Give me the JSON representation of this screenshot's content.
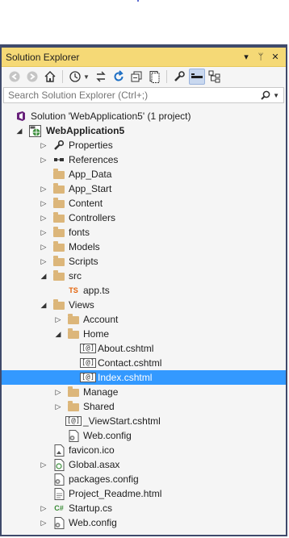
{
  "window": {
    "title": "Solution Explorer",
    "title_buttons": [
      "▾",
      "ᛘ",
      "✕"
    ]
  },
  "search": {
    "placeholder": "Search Solution Explorer (Ctrl+;)"
  },
  "tree": [
    {
      "label": "Solution 'WebApplication5' (1 project)",
      "depth": 0,
      "expander": "",
      "icon": "solution-icon",
      "bold": false,
      "selected": false
    },
    {
      "label": "WebApplication5",
      "depth": 0,
      "expander": "open",
      "icon": "web-project-icon",
      "bold": true,
      "selected": false
    },
    {
      "label": "Properties",
      "depth": 1,
      "expander": "closed",
      "icon": "wrench-icon",
      "bold": false,
      "selected": false
    },
    {
      "label": "References",
      "depth": 1,
      "expander": "closed",
      "icon": "references-icon",
      "bold": false,
      "selected": false
    },
    {
      "label": "App_Data",
      "depth": 1,
      "expander": "",
      "icon": "folder-icon",
      "bold": false,
      "selected": false
    },
    {
      "label": "App_Start",
      "depth": 1,
      "expander": "closed",
      "icon": "folder-icon",
      "bold": false,
      "selected": false
    },
    {
      "label": "Content",
      "depth": 1,
      "expander": "closed",
      "icon": "folder-icon",
      "bold": false,
      "selected": false
    },
    {
      "label": "Controllers",
      "depth": 1,
      "expander": "closed",
      "icon": "folder-icon",
      "bold": false,
      "selected": false
    },
    {
      "label": "fonts",
      "depth": 1,
      "expander": "closed",
      "icon": "folder-icon",
      "bold": false,
      "selected": false
    },
    {
      "label": "Models",
      "depth": 1,
      "expander": "closed",
      "icon": "folder-icon",
      "bold": false,
      "selected": false
    },
    {
      "label": "Scripts",
      "depth": 1,
      "expander": "closed",
      "icon": "folder-icon",
      "bold": false,
      "selected": false
    },
    {
      "label": "src",
      "depth": 1,
      "expander": "open",
      "icon": "folder-icon",
      "bold": false,
      "selected": false
    },
    {
      "label": "app.ts",
      "depth": 2,
      "expander": "",
      "icon": "typescript-icon",
      "bold": false,
      "selected": false
    },
    {
      "label": "Views",
      "depth": 1,
      "expander": "open",
      "icon": "folder-icon",
      "bold": false,
      "selected": false
    },
    {
      "label": "Account",
      "depth": 2,
      "expander": "closed",
      "icon": "folder-icon",
      "bold": false,
      "selected": false
    },
    {
      "label": "Home",
      "depth": 2,
      "expander": "open",
      "icon": "folder-icon",
      "bold": false,
      "selected": false
    },
    {
      "label": "About.cshtml",
      "depth": 3,
      "expander": "",
      "icon": "razor-icon",
      "bold": false,
      "selected": false
    },
    {
      "label": "Contact.cshtml",
      "depth": 3,
      "expander": "",
      "icon": "razor-icon",
      "bold": false,
      "selected": false
    },
    {
      "label": "Index.cshtml",
      "depth": 3,
      "expander": "",
      "icon": "razor-icon",
      "bold": false,
      "selected": true
    },
    {
      "label": "Manage",
      "depth": 2,
      "expander": "closed",
      "icon": "folder-icon",
      "bold": false,
      "selected": false
    },
    {
      "label": "Shared",
      "depth": 2,
      "expander": "closed",
      "icon": "folder-icon",
      "bold": false,
      "selected": false
    },
    {
      "label": "_ViewStart.cshtml",
      "depth": 2,
      "expander": "",
      "icon": "razor-icon",
      "bold": false,
      "selected": false
    },
    {
      "label": "Web.config",
      "depth": 2,
      "expander": "",
      "icon": "config-file-icon",
      "bold": false,
      "selected": false
    },
    {
      "label": "favicon.ico",
      "depth": 1,
      "expander": "",
      "icon": "image-file-icon",
      "bold": false,
      "selected": false
    },
    {
      "label": "Global.asax",
      "depth": 1,
      "expander": "closed",
      "icon": "global-asax-icon",
      "bold": false,
      "selected": false
    },
    {
      "label": "packages.config",
      "depth": 1,
      "expander": "",
      "icon": "config-file-icon",
      "bold": false,
      "selected": false
    },
    {
      "label": "Project_Readme.html",
      "depth": 1,
      "expander": "",
      "icon": "html-file-icon",
      "bold": false,
      "selected": false
    },
    {
      "label": "Startup.cs",
      "depth": 1,
      "expander": "closed",
      "icon": "csharp-icon",
      "bold": false,
      "selected": false
    },
    {
      "label": "Web.config",
      "depth": 1,
      "expander": "closed",
      "icon": "config-file-icon",
      "bold": false,
      "selected": false
    }
  ],
  "colors": {
    "title_bar": "#f5d976",
    "selection": "#3399ff",
    "folder": "#dcb67a"
  }
}
